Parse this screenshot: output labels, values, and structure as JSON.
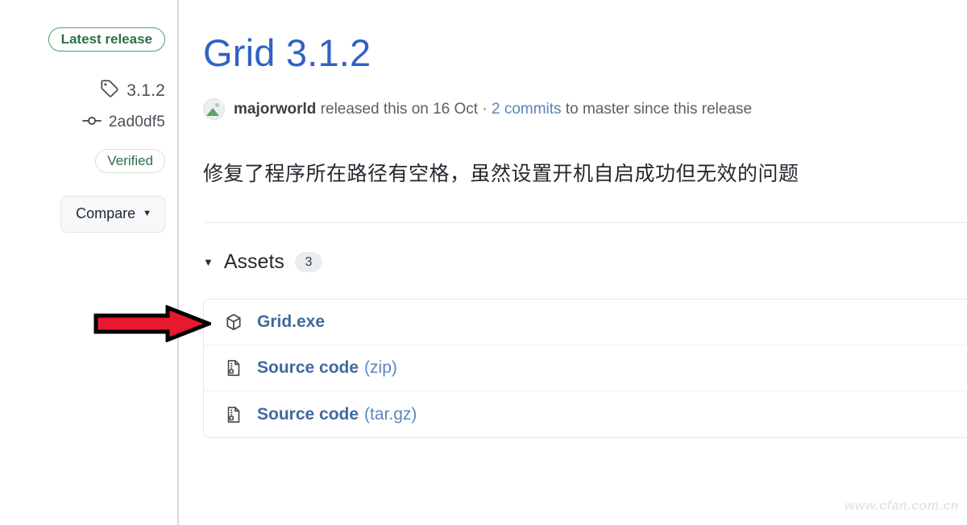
{
  "sidebar": {
    "latest_release_badge": "Latest release",
    "tag": {
      "icon": "tag-icon",
      "value": "3.1.2"
    },
    "commit": {
      "icon": "git-commit-icon",
      "value": "2ad0df5"
    },
    "verified_badge": "Verified",
    "compare_button": {
      "label": "Compare",
      "caret": "▼"
    }
  },
  "main": {
    "title": "Grid 3.1.2",
    "meta": {
      "avatar_icon": "broken-image-avatar-icon",
      "author": "majorworld",
      "released_text": "released this on 16 Oct ·",
      "commits_link": "2 commits",
      "trailing_text": "to master since this release"
    },
    "body": "修复了程序所在路径有空格，虽然设置开机自启成功但无效的问题",
    "assets": {
      "caret": "▼",
      "label": "Assets",
      "count": "3",
      "items": [
        {
          "icon": "package-cube-icon",
          "name": "Grid.exe",
          "suffix": ""
        },
        {
          "icon": "file-zip-icon",
          "name": "Source code",
          "suffix": "(zip)"
        },
        {
          "icon": "file-zip-icon",
          "name": "Source code",
          "suffix": "(tar.gz)"
        }
      ]
    }
  },
  "annotation": {
    "arrow_icon": "red-right-arrow-icon",
    "arrow_fill": "#e8192c",
    "arrow_stroke": "#000000"
  },
  "watermark": "www.cfan.com.cn",
  "colors": {
    "link_blue": "#41699e",
    "title_blue": "#2f62c4",
    "badge_green": "#2f6e47",
    "border_green": "#4f9c6b",
    "text_gray": "#57606a",
    "divider": "#e7e9ec"
  }
}
